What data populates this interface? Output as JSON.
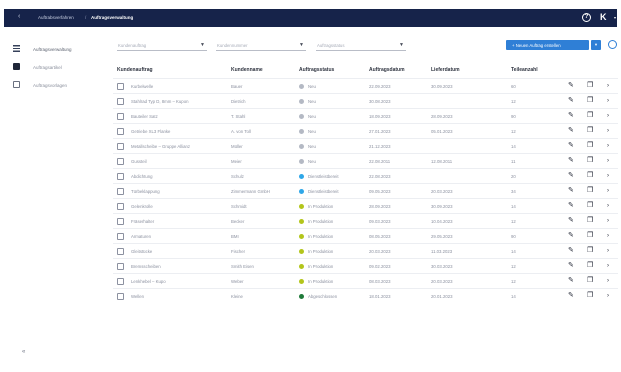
{
  "topbar": {
    "back_icon": "arrow-left-icon",
    "breadcrumb_parent": "Auftrabsverfahren",
    "breadcrumb_separator": "/",
    "breadcrumb_current": "Auftragsverwaltung",
    "help_label": "?",
    "logo_text": "K"
  },
  "sidebar": {
    "items": [
      {
        "label": "Auftragsverwaltung",
        "icon": "list-icon"
      },
      {
        "label": "Auftragsartikel",
        "icon": "cube-icon"
      },
      {
        "label": "Auftragsvorlagen",
        "icon": "document-icon"
      }
    ],
    "collapse_label": "«"
  },
  "filters": [
    {
      "placeholder": "Kundenauftrag"
    },
    {
      "placeholder": "Kundennummer"
    },
    {
      "placeholder": "Auftragsstatus"
    }
  ],
  "actions": {
    "new_order_label": "+  Neuen Auftrag erstellen",
    "caret_label": "▾"
  },
  "table": {
    "columns": [
      "Kundenauftrag",
      "Kundenname",
      "Auftragsstatus",
      "Auftragsdatum",
      "Lieferdatum",
      "Teileanzahl"
    ],
    "rows": [
      {
        "order": "Kurbelwelle",
        "customer": "Bauer",
        "status": "Neu",
        "status_color": "#b4b9c4",
        "order_date": "22.09.2023",
        "delivery": "30.09.2023",
        "parts": "60"
      },
      {
        "order": "Stahlrad Typ D, 8mm – Kupon",
        "customer": "Dietrich",
        "status": "Neu",
        "status_color": "#b4b9c4",
        "order_date": "30.08.2023",
        "delivery": "",
        "parts": "12"
      },
      {
        "order": "Bauteiler Satz",
        "customer": "T. Stahl",
        "status": "Neu",
        "status_color": "#b4b9c4",
        "order_date": "18.09.2023",
        "delivery": "28.09.2023",
        "parts": "90"
      },
      {
        "order": "Getriebe XL3 Flanke",
        "customer": "A. von Toll",
        "status": "Neu",
        "status_color": "#b4b9c4",
        "order_date": "27.01.2023",
        "delivery": "05.01.2023",
        "parts": "12"
      },
      {
        "order": "Metallscheibe – Gruppe Allianz",
        "customer": "Müller",
        "status": "Neu",
        "status_color": "#b4b9c4",
        "order_date": "21.12.2023",
        "delivery": "",
        "parts": "14"
      },
      {
        "order": "Gussteil",
        "customer": "Meier",
        "status": "Neu",
        "status_color": "#b4b9c4",
        "order_date": "22.08.2011",
        "delivery": "12.08.2011",
        "parts": "11"
      },
      {
        "order": "Abdichtung",
        "customer": "Schulz",
        "status": "Dienstleistbereit",
        "status_color": "#2fa7e8",
        "order_date": "22.08.2023",
        "delivery": "",
        "parts": "20"
      },
      {
        "order": "Türbeklappung",
        "customer": "Zimmermann GmbH",
        "status": "Dienstleistbereit",
        "status_color": "#2fa7e8",
        "order_date": "09.05.2023",
        "delivery": "20.03.2023",
        "parts": "34"
      },
      {
        "order": "Gelenkrolle",
        "customer": "Schmidt",
        "status": "In Produktion",
        "status_color": "#b3c51b",
        "order_date": "28.09.2023",
        "delivery": "30.09.2023",
        "parts": "14"
      },
      {
        "order": "Fräserhalter",
        "customer": "Becker",
        "status": "In Produktion",
        "status_color": "#b3c51b",
        "order_date": "09.03.2023",
        "delivery": "10.04.2023",
        "parts": "12"
      },
      {
        "order": "Armaturen",
        "customer": "BMI",
        "status": "In Produktion",
        "status_color": "#b3c51b",
        "order_date": "08.05.2023",
        "delivery": "29.05.2023",
        "parts": "90"
      },
      {
        "order": "Gleitstücke",
        "customer": "Fischer",
        "status": "In Produktion",
        "status_color": "#b3c51b",
        "order_date": "20.03.2023",
        "delivery": "11.03.2023",
        "parts": "14"
      },
      {
        "order": "Bremsscheiben",
        "customer": "Smith Eisen",
        "status": "In Produktion",
        "status_color": "#b3c51b",
        "order_date": "09.02.2023",
        "delivery": "30.03.2023",
        "parts": "12"
      },
      {
        "order": "Lenkhebel – Kupo",
        "customer": "Weber",
        "status": "In Produktion",
        "status_color": "#b3c51b",
        "order_date": "08.03.2023",
        "delivery": "20.03.2023",
        "parts": "12"
      },
      {
        "order": "Wellen",
        "customer": "Kleine",
        "status": "Abgeschlossen",
        "status_color": "#1f7a3a",
        "order_date": "18.01.2023",
        "delivery": "20.01.2023",
        "parts": "14"
      }
    ],
    "row_actions": {
      "edit_icon": "pencil-icon",
      "copy_icon": "copy-icon",
      "more_icon": "chevron-right-icon"
    }
  }
}
